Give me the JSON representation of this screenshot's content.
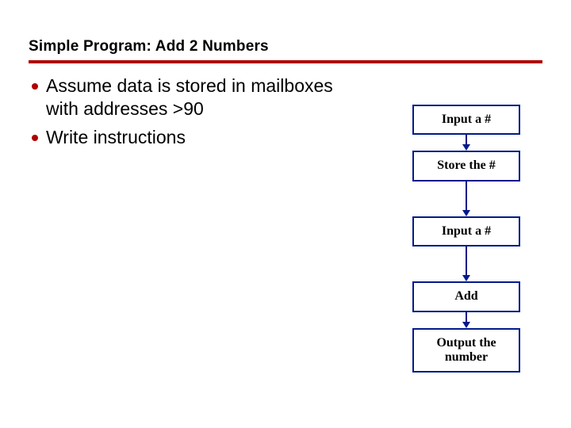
{
  "title": "Simple Program:  Add 2 Numbers",
  "bullets": [
    "Assume data is stored in mailboxes with addresses >90",
    "Write instructions"
  ],
  "flow": {
    "steps": [
      {
        "label": "Input a #"
      },
      {
        "label": "Store the #"
      },
      {
        "label": "Input a #"
      },
      {
        "label": "Add"
      },
      {
        "label": "Output the number"
      }
    ],
    "gaps": [
      "short",
      "long",
      "long",
      "short"
    ]
  }
}
